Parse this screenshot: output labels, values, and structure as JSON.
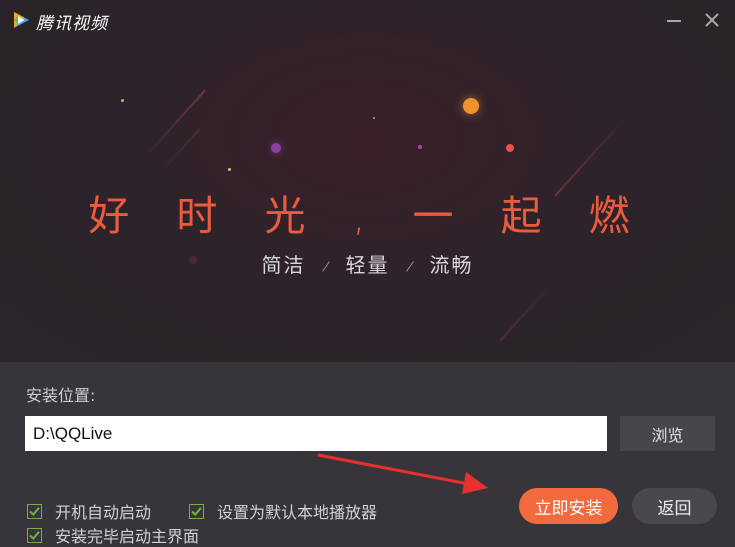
{
  "app": {
    "title": "腾讯视频"
  },
  "window_controls": {
    "minimize_icon": "minimize-icon",
    "close_icon": "close-icon"
  },
  "hero": {
    "slogan": "好 时 光 , 一 起 燃",
    "features": [
      "简洁",
      "轻量",
      "流畅"
    ]
  },
  "install": {
    "location_label": "安装位置:",
    "path_value": "D:\\QQLive",
    "browse_label": "浏览"
  },
  "options": [
    {
      "label": "开机自动启动",
      "checked": true
    },
    {
      "label": "设置为默认本地播放器",
      "checked": true
    },
    {
      "label": "安装完毕启动主界面",
      "checked": true
    }
  ],
  "buttons": {
    "install_label": "立即安装",
    "back_label": "返回"
  },
  "colors": {
    "accent": "#f26a3e",
    "slogan": "#ec5b3c",
    "check": "#6fb53a",
    "annotation_arrow": "#e8312f"
  }
}
